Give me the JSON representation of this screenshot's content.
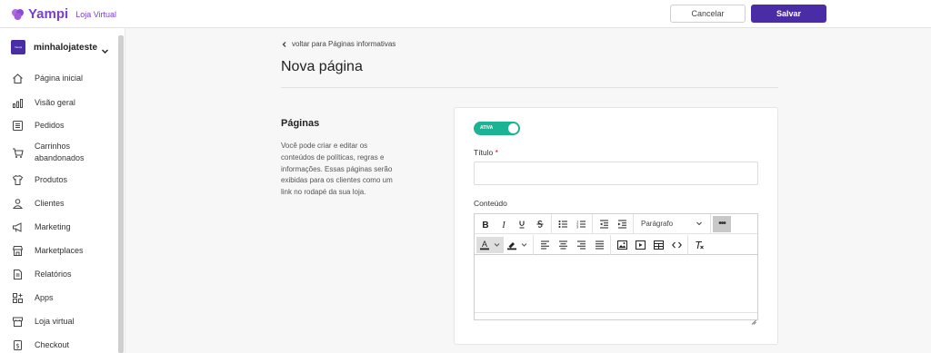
{
  "header": {
    "brand": "Yampi",
    "product": "Loja Virtual",
    "cancel_label": "Cancelar",
    "save_label": "Salvar"
  },
  "sidebar": {
    "store_name": "minhalojateste",
    "store_avatar": "Yampi",
    "items": [
      {
        "label": "Página inicial",
        "icon": "home-icon"
      },
      {
        "label": "Visão geral",
        "icon": "chart-bars-icon"
      },
      {
        "label": "Pedidos",
        "icon": "orders-icon"
      },
      {
        "label": "Carrinhos abandonados",
        "icon": "cart-icon"
      },
      {
        "label": "Produtos",
        "icon": "shirt-icon"
      },
      {
        "label": "Clientes",
        "icon": "user-icon"
      },
      {
        "label": "Marketing",
        "icon": "megaphone-icon"
      },
      {
        "label": "Marketplaces",
        "icon": "storefront-icon"
      },
      {
        "label": "Relatórios",
        "icon": "report-icon"
      },
      {
        "label": "Apps",
        "icon": "apps-icon"
      },
      {
        "label": "Loja virtual",
        "icon": "store-icon"
      },
      {
        "label": "Checkout",
        "icon": "checkout-icon"
      }
    ]
  },
  "main": {
    "back_link": "voltar para Páginas informativas",
    "title": "Nova página",
    "section_title": "Páginas",
    "section_description": "Você pode criar e editar os conteúdos de políticas, regras e informações. Essas páginas serão exibidas para os clientes como um link no rodapé da sua loja.",
    "toggle_label": "ATIVA",
    "title_field_label": "Título",
    "required_mark": "*",
    "title_value": "",
    "content_label": "Conteúdo",
    "format_select_value": "Parágrafo"
  },
  "colors": {
    "brand": "#7a3fd0",
    "primary_button": "#4a2ca6",
    "toggle_active": "#1ab394"
  }
}
